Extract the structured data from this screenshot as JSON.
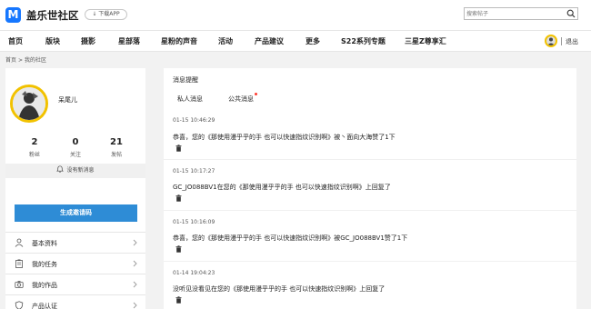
{
  "header": {
    "logo_glyph": "M",
    "logo_text": "盖乐世社区",
    "download_label": "↓ 下载APP",
    "search_placeholder": "搜索帖子"
  },
  "nav": {
    "items": [
      "首页",
      "版块",
      "摄影",
      "星部落",
      "星粉的声音",
      "活动",
      "产品建议",
      "更多",
      "S22系列专题",
      "三星Z尊享汇"
    ],
    "logout": "退出"
  },
  "breadcrumb": [
    "首页",
    ">",
    "我的社区"
  ],
  "profile": {
    "username": "呆尾儿",
    "stats": [
      {
        "value": "2",
        "label": "粉丝"
      },
      {
        "value": "0",
        "label": "关注"
      },
      {
        "value": "21",
        "label": "发帖"
      }
    ],
    "notify_text": "没有新消息",
    "qr_button": "生成邀请码"
  },
  "menu": [
    {
      "label": "基本资料",
      "icon": "user-icon"
    },
    {
      "label": "我的任务",
      "icon": "clipboard-icon"
    },
    {
      "label": "我的作品",
      "icon": "camera-icon"
    },
    {
      "label": "产品认证",
      "icon": "shield-icon"
    }
  ],
  "messages_panel": {
    "title": "消息提醒",
    "tabs": [
      "私人消息",
      "公共消息"
    ],
    "messages": [
      {
        "time": "01-15 10:46:29",
        "text": "恭喜，您的《那使用漫乎乎的手 也可以快速指纹识别啊》被丶面向大海赞了1下"
      },
      {
        "time": "01-15 10:17:27",
        "text": "GC_JO088BV1在您的《那使用漫乎乎的手 也可以快速指纹识别啊》上回复了"
      },
      {
        "time": "01-15 10:16:09",
        "text": "恭喜，您的《那使用漫乎乎的手 也可以快速指纹识别啊》被GC_JO088BV1赞了1下"
      },
      {
        "time": "01-14 19:04:23",
        "text": "没听见没看见在您的《那使用漫乎乎的手 也可以快速指纹识别啊》上回复了"
      }
    ]
  },
  "colors": {
    "accent_blue": "#2e8cd6",
    "logo_blue": "#1677ff",
    "avatar_ring": "#f2c200",
    "unread_dot": "#ff3b30"
  }
}
